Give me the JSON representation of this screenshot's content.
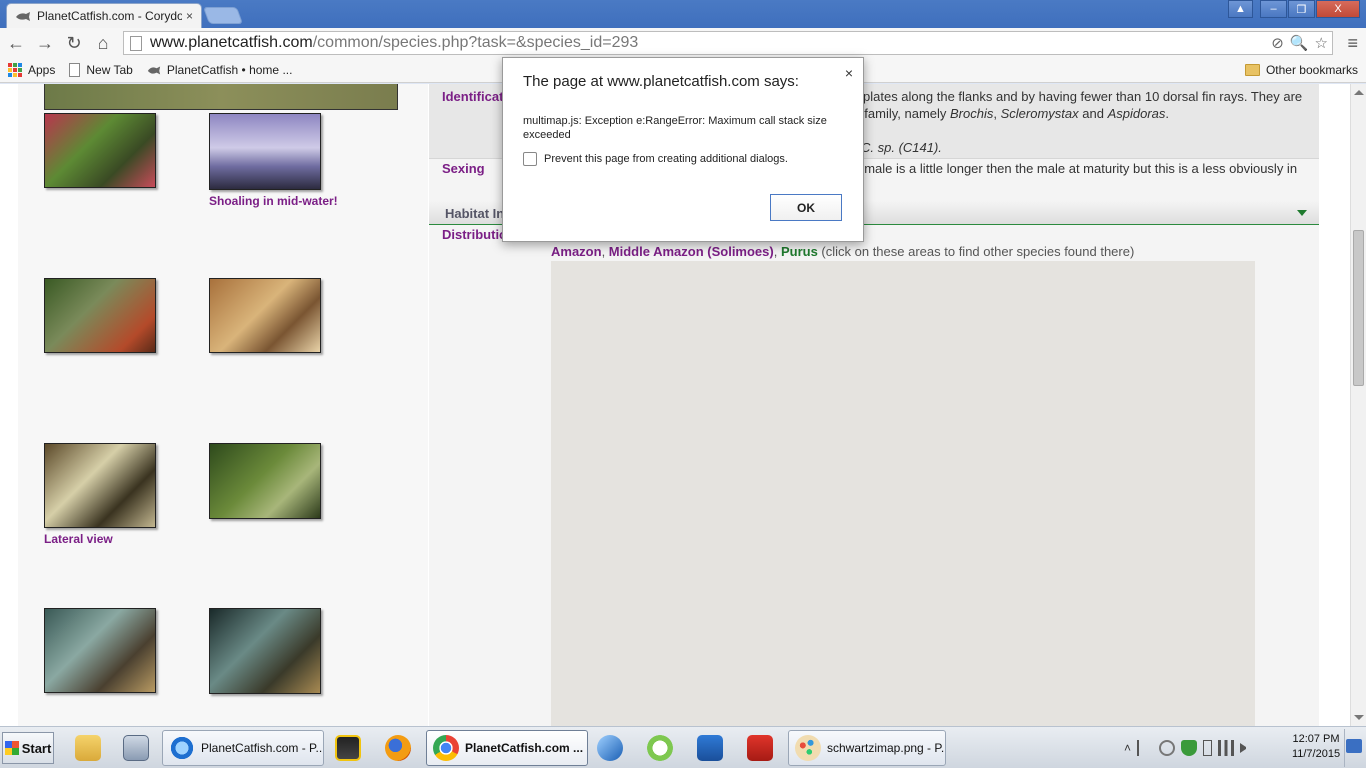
{
  "browser": {
    "tab_title": "PlanetCatfish.com - Corydoras",
    "tab_close": "×",
    "url_host": "www.planetcatfish.com",
    "url_path": "/common/species.php?task=&species_id=293",
    "window_controls": {
      "user": "▲",
      "minimize": "–",
      "restore": "❐",
      "close": "X"
    },
    "nav": {
      "back": "←",
      "forward": "→",
      "reload": "↻",
      "home": "⌂"
    },
    "omnibox_icons": [
      "⊘",
      "🔍",
      "☆"
    ],
    "menu": "≡",
    "bookmarks": {
      "apps": "Apps",
      "new_tab": "New Tab",
      "planetcatfish": "PlanetCatfish • home ...",
      "other": "Other bookmarks"
    }
  },
  "page": {
    "gallery": [
      {
        "caption": ""
      },
      {
        "caption": "Shoaling in mid-water!"
      },
      {
        "caption": ""
      },
      {
        "caption": ""
      },
      {
        "caption": "Lateral view"
      },
      {
        "caption": ""
      },
      {
        "caption": ""
      },
      {
        "caption": ""
      }
    ],
    "identification": {
      "label": "Identificati",
      "line1": "plates along the flanks and by having fewer than 10 dorsal fin rays. They are",
      "line2_pre": "sub-family, namely ",
      "genus1": "Brochis",
      "sep1": ", ",
      "genus2": "Scleromystax",
      "sep2": " and ",
      "genus3": "Aspidoras",
      "end": ".",
      "line3": "C. sp. (C141)."
    },
    "sexing": {
      "label": "Sexing",
      "line1": "emale is a little longer then the male at maturity but this is a less obviously in"
    },
    "habitat_header": "Habitat In",
    "distribution": {
      "label": "Distributio",
      "link1": "Amazon",
      "comma1": ", ",
      "link2": "Middle Amazon (Solimoes)",
      "comma2": ", ",
      "link3": "Purus",
      "note": " (click on these areas to find other species found there)"
    }
  },
  "dialog": {
    "title": "The page at www.planetcatfish.com says:",
    "close": "×",
    "message": "multimap.js: Exception e:RangeError: Maximum call stack size exceeded",
    "checkbox_label": "Prevent this page from creating additional dialogs.",
    "checkbox_checked": false,
    "ok_label": "OK"
  },
  "taskbar": {
    "start": "Start",
    "tasks": [
      {
        "label": "PlanetCatfish.com - P..."
      },
      {
        "label": "PlanetCatfish.com ..."
      },
      {
        "label": "schwartzimap.png - P..."
      }
    ],
    "tray_expand": "˄",
    "time": "12:07 PM",
    "date": "11/7/2015"
  }
}
